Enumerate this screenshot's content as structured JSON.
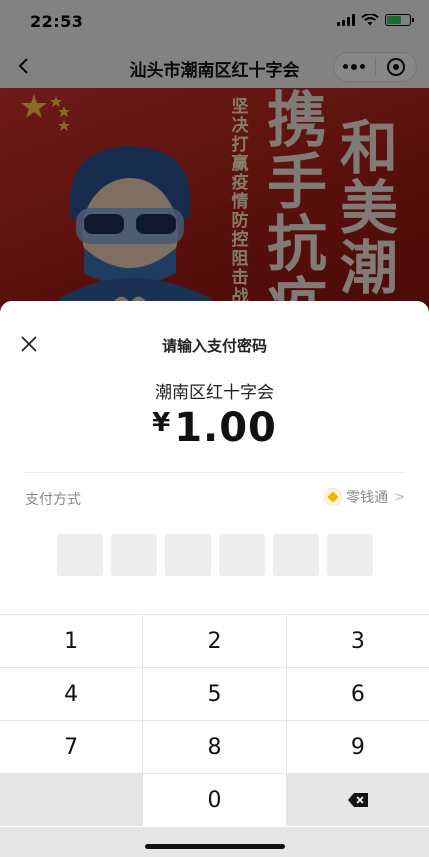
{
  "status_bar": {
    "time": "22:53"
  },
  "nav": {
    "title": "汕头市潮南区红十字会"
  },
  "banner": {
    "slogan_small": "坚决打赢疫情防控阻击战",
    "slogan_big_col1": "携手抗疫",
    "slogan_big_col2": "和美潮"
  },
  "sheet": {
    "title": "请输入支付密码",
    "payee": "潮南区红十字会",
    "currency": "¥",
    "amount": "1.00",
    "method_label": "支付方式",
    "method_value": "零钱通",
    "password_length": 6
  },
  "keypad": {
    "rows": [
      [
        "1",
        "2",
        "3"
      ],
      [
        "4",
        "5",
        "6"
      ],
      [
        "7",
        "8",
        "9"
      ]
    ],
    "zero": "0"
  },
  "colors": {
    "banner_red": "#a01d18",
    "coin_gold": "#f5b400",
    "battery_green": "#34c759"
  }
}
